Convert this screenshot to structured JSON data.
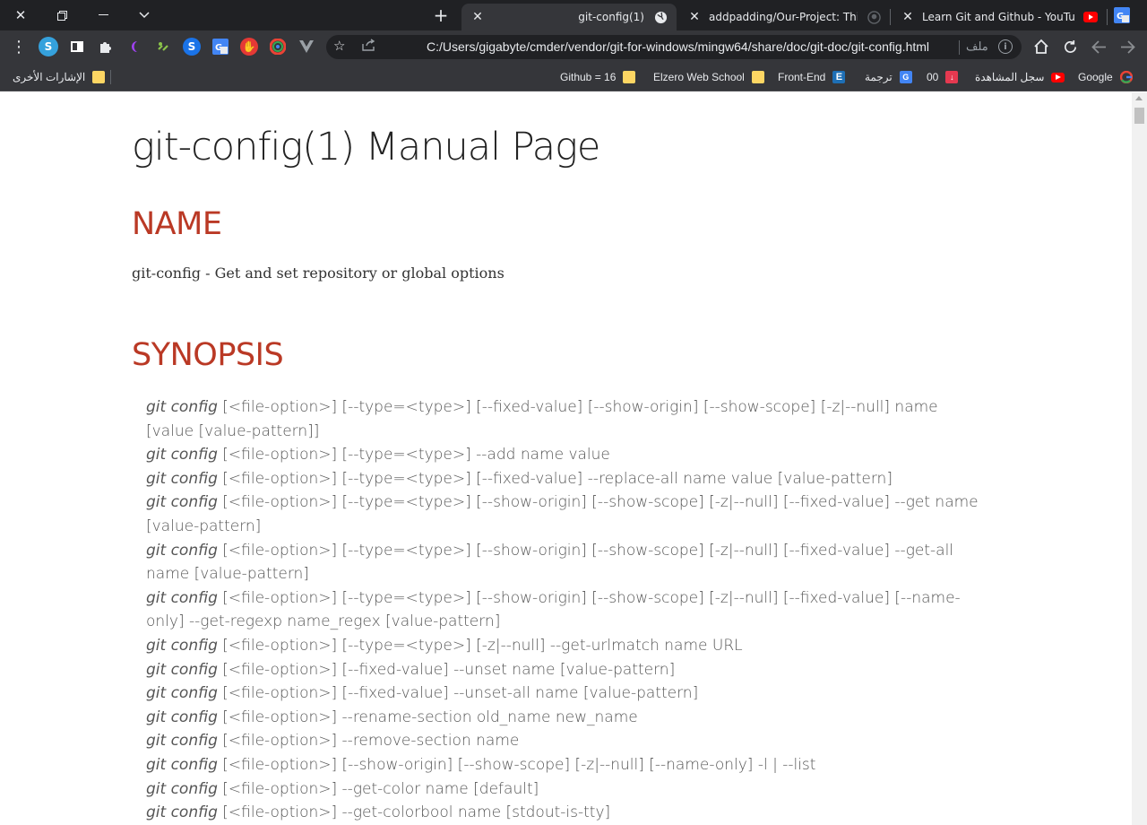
{
  "window": {
    "tabs": [
      {
        "title": "git-config(1)",
        "icon": "globe-icon",
        "active": true
      },
      {
        "title": "addpadding/Our-Project: This is G",
        "icon": "github-icon",
        "active": false
      },
      {
        "title": "Learn Git and Github - YouTube",
        "icon": "youtube-icon",
        "active": false
      }
    ]
  },
  "toolbar": {
    "url": "C:/Users/gigabyte/cmder/vendor/git-for-windows/mingw64/share/doc/git-doc/git-config.html",
    "site_label": "ملف"
  },
  "bookmarks": {
    "other": "الإشارات الأخرى",
    "items": [
      {
        "label": "Google",
        "icon": "google-icon"
      },
      {
        "label": "سجل المشاهدة",
        "icon": "youtube-icon"
      },
      {
        "label": "00",
        "icon": "download-icon"
      },
      {
        "label": "ترجمة",
        "icon": "translate-icon"
      },
      {
        "label": "Front-End",
        "icon": "e-icon"
      },
      {
        "label": "Elzero Web School",
        "icon": "folder-icon"
      },
      {
        "label": "Github = 16",
        "icon": "folder-icon"
      }
    ]
  },
  "page": {
    "title": "git-config(1) Manual Page",
    "name_heading": "NAME",
    "name_desc": "git-config - Get and set repository or global options",
    "synopsis_heading": "SYNOPSIS",
    "synopsis_cmd": "git config",
    "synopsis": [
      " [<file-option>] [--type=<type>] [--fixed-value] [--show-origin] [--show-scope] [-z|--null] name [value [value-pattern]]",
      " [<file-option>] [--type=<type>] --add name value",
      " [<file-option>] [--type=<type>] [--fixed-value] --replace-all name value [value-pattern]",
      " [<file-option>] [--type=<type>] [--show-origin] [--show-scope] [-z|--null] [--fixed-value] --get name [value-pattern]",
      " [<file-option>] [--type=<type>] [--show-origin] [--show-scope] [-z|--null] [--fixed-value] --get-all name [value-pattern]",
      " [<file-option>] [--type=<type>] [--show-origin] [--show-scope] [-z|--null] [--fixed-value] [--name-only] --get-regexp name_regex [value-pattern]",
      " [<file-option>] [--type=<type>] [-z|--null] --get-urlmatch name URL",
      " [<file-option>] [--fixed-value] --unset name [value-pattern]",
      " [<file-option>] [--fixed-value] --unset-all name [value-pattern]",
      " [<file-option>] --rename-section old_name new_name",
      " [<file-option>] --remove-section name",
      " [<file-option>] [--show-origin] [--show-scope] [-z|--null] [--name-only] -l | --list",
      " [<file-option>] --get-color name [default]",
      " [<file-option>] --get-colorbool name [stdout-is-tty]"
    ]
  },
  "colors": {
    "heading": "#ba3925",
    "chrome_dark": "#202124",
    "chrome_toolbar": "#35363a"
  }
}
